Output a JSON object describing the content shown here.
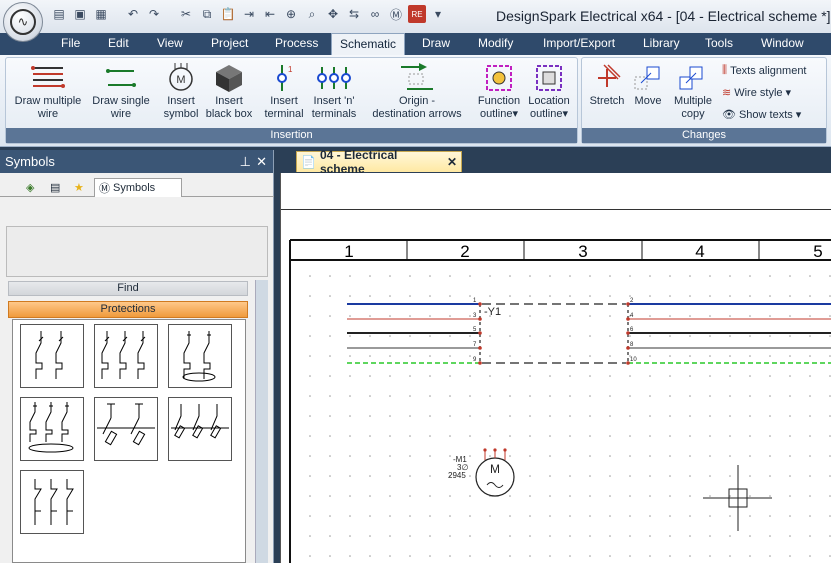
{
  "app": {
    "title": "DesignSpark Electrical x64 - [04 - Electrical scheme *]"
  },
  "menu": [
    "File",
    "Edit",
    "View",
    "Project",
    "Process",
    "Schematic",
    "Draw",
    "Modify",
    "Import/Export",
    "Library",
    "Tools",
    "Window"
  ],
  "menu_active": "Schematic",
  "ribbon": {
    "insertion": {
      "label": "Insertion",
      "draw_multiple_wire": [
        "Draw multiple",
        "wire"
      ],
      "draw_single_wire": [
        "Draw single",
        "wire"
      ],
      "insert_symbol": [
        "Insert",
        "symbol"
      ],
      "insert_black_box": [
        "Insert",
        "black box"
      ],
      "insert_terminal": [
        "Insert",
        "terminal"
      ],
      "insert_n_terminals": [
        "Insert 'n'",
        "terminals"
      ],
      "origin_destination": [
        "Origin -",
        "destination arrows"
      ],
      "function_outline": [
        "Function",
        "outline"
      ],
      "location_outline": [
        "Location",
        "outline"
      ]
    },
    "changes": {
      "label": "Changes",
      "stretch": "Stretch",
      "move": "Move",
      "multiple_copy": [
        "Multiple",
        "copy"
      ],
      "texts_alignment": "Texts alignment",
      "wire_style": "Wire style",
      "show_texts": "Show texts"
    }
  },
  "panel": {
    "title": "Symbols",
    "tab_label": "Symbols",
    "find_label": "Find",
    "category_label": "Protections"
  },
  "document": {
    "tab_title": "04 - Electrical scheme",
    "columns": [
      "1",
      "2",
      "3",
      "4",
      "5"
    ],
    "wire_labels": {
      "left": [
        "1",
        "3",
        "5",
        "7",
        "9"
      ],
      "right": [
        "2",
        "4",
        "6",
        "8",
        "10"
      ]
    },
    "component_tag": "-Y1",
    "motor": {
      "tag": "-M1",
      "phase": "3∅",
      "code": "2945",
      "letter": "M"
    }
  },
  "colors": {
    "menubar": "#2f4a6b",
    "ribbon_group_label": "#5b7596",
    "protections_bar": "#f09a3c",
    "doc_tab": "#ffe9a3",
    "wire_blue": "#1a3aa0",
    "wire_red": "#c0392b",
    "wire_black": "#222222",
    "wire_gray": "#9a9a9a",
    "wire_green_dashed": "#28c828"
  }
}
